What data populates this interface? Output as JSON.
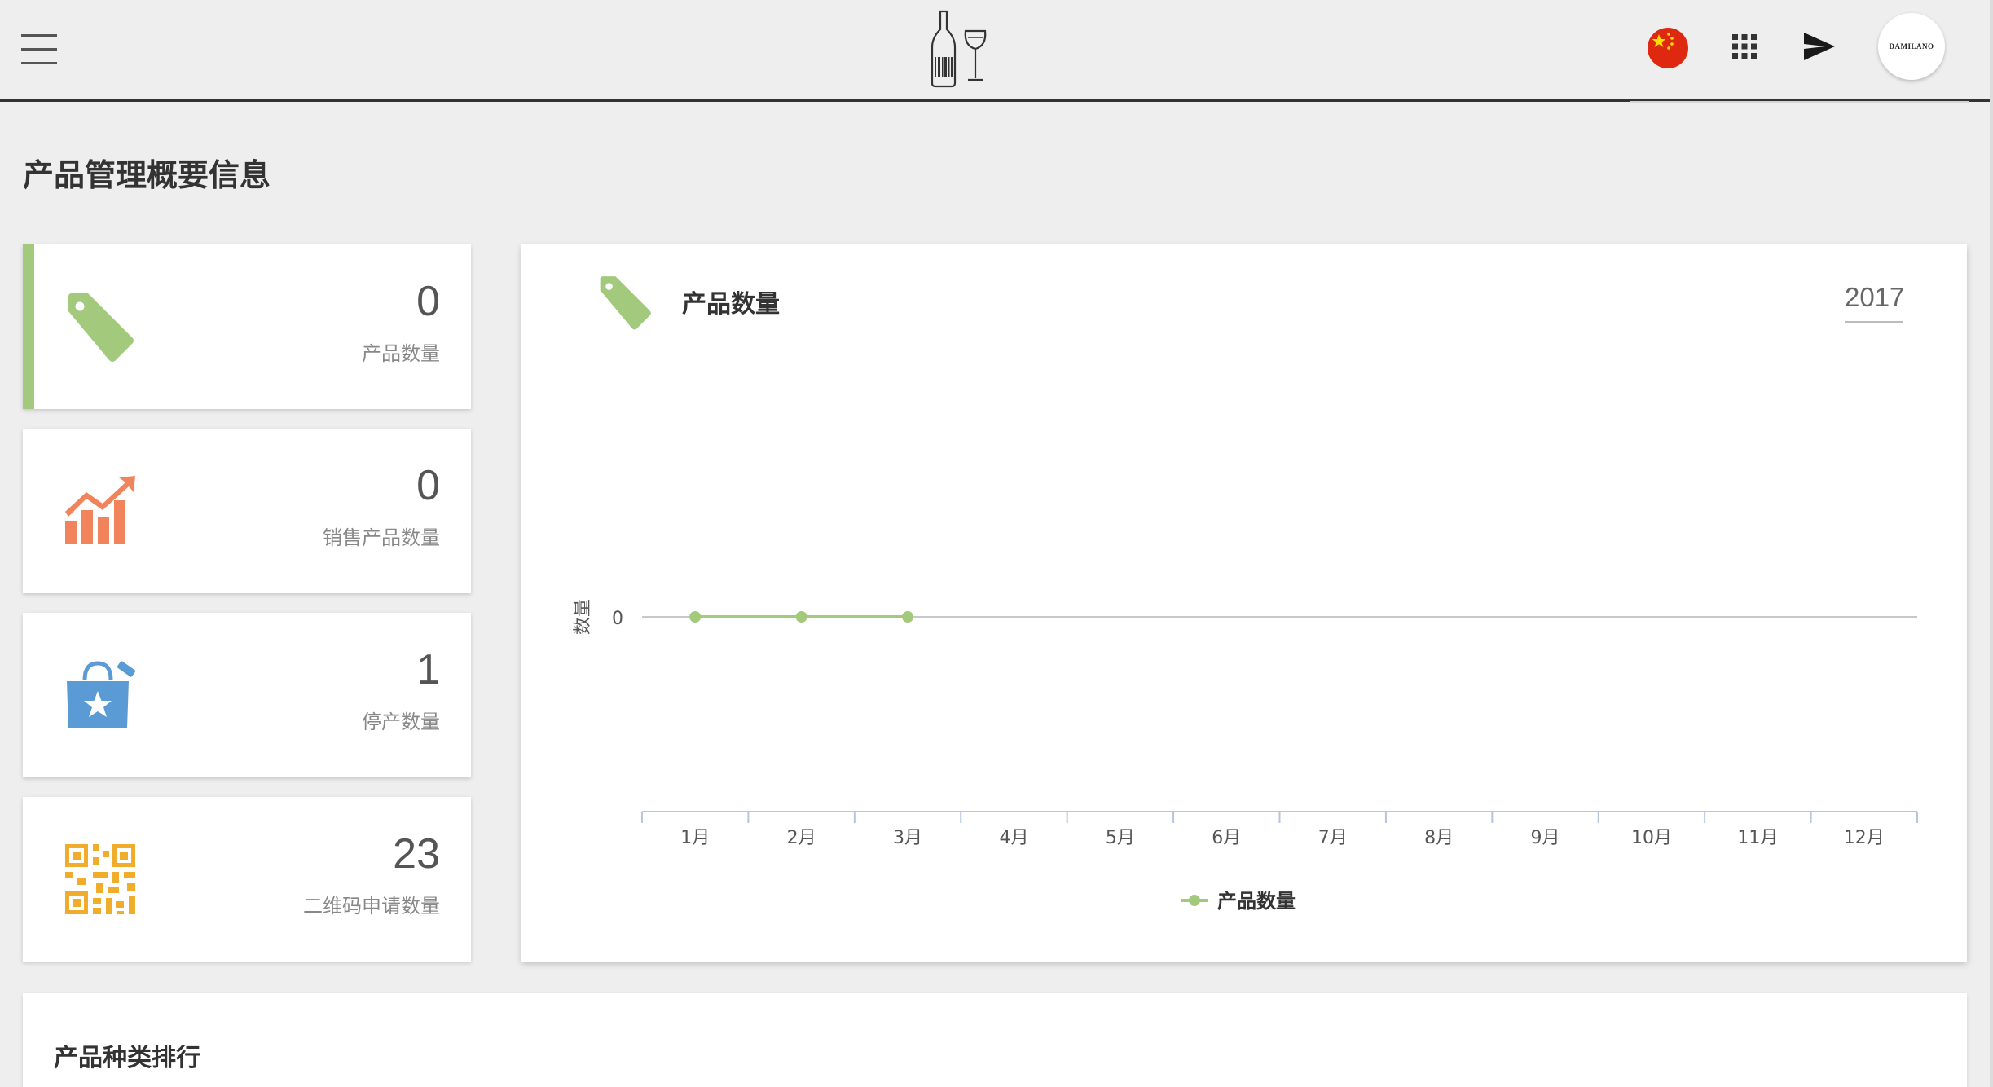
{
  "header": {
    "language_flag_icon": "china-flag-icon",
    "apps_icon": "apps-grid-icon",
    "send_icon": "send-icon",
    "avatar_text": "DAMILANO"
  },
  "page": {
    "title": "产品管理概要信息"
  },
  "stats": [
    {
      "value": "0",
      "label": "产品数量",
      "icon": "tag-icon",
      "color": "#a2c97c",
      "active": true
    },
    {
      "value": "0",
      "label": "销售产品数量",
      "icon": "trending-up-icon",
      "color": "#f2845c",
      "active": false
    },
    {
      "value": "1",
      "label": "停产数量",
      "icon": "shopping-bag-star-icon",
      "color": "#5b9bd5",
      "active": false
    },
    {
      "value": "23",
      "label": "二维码申请数量",
      "icon": "qr-code-icon",
      "color": "#f0ad2c",
      "active": false
    }
  ],
  "chart_panel": {
    "title": "产品数量",
    "year": "2017",
    "icon": "tag-icon"
  },
  "chart_data": {
    "type": "line",
    "title": "",
    "xlabel": "",
    "ylabel": "数量",
    "categories": [
      "1月",
      "2月",
      "3月",
      "4月",
      "5月",
      "6月",
      "7月",
      "8月",
      "9月",
      "10月",
      "11月",
      "12月"
    ],
    "y_ticks": [
      "0"
    ],
    "series": [
      {
        "name": "产品数量",
        "color": "#a2c97c",
        "values": [
          0,
          0,
          0,
          null,
          null,
          null,
          null,
          null,
          null,
          null,
          null,
          null
        ]
      }
    ],
    "legend_position": "bottom-center",
    "grid": false
  },
  "ranking": {
    "title": "产品种类排行"
  }
}
